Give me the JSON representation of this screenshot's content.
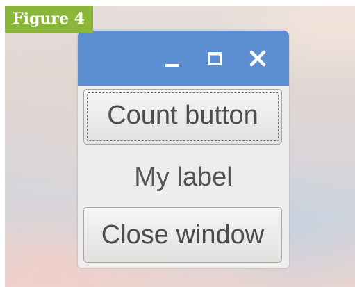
{
  "figure_label": "Figure 4",
  "window": {
    "titlebar": {
      "color": "#5b8fd2",
      "controls": [
        {
          "name": "minimize",
          "icon": "minimize-icon"
        },
        {
          "name": "maximize",
          "icon": "maximize-icon"
        },
        {
          "name": "close",
          "icon": "close-icon"
        }
      ]
    },
    "count_button_label": "Count button",
    "label_text": "My label",
    "close_button_label": "Close window"
  },
  "colors": {
    "badge": "#8ab73a",
    "titlebar": "#5b8fd2",
    "window_bg": "#eeedeb"
  }
}
